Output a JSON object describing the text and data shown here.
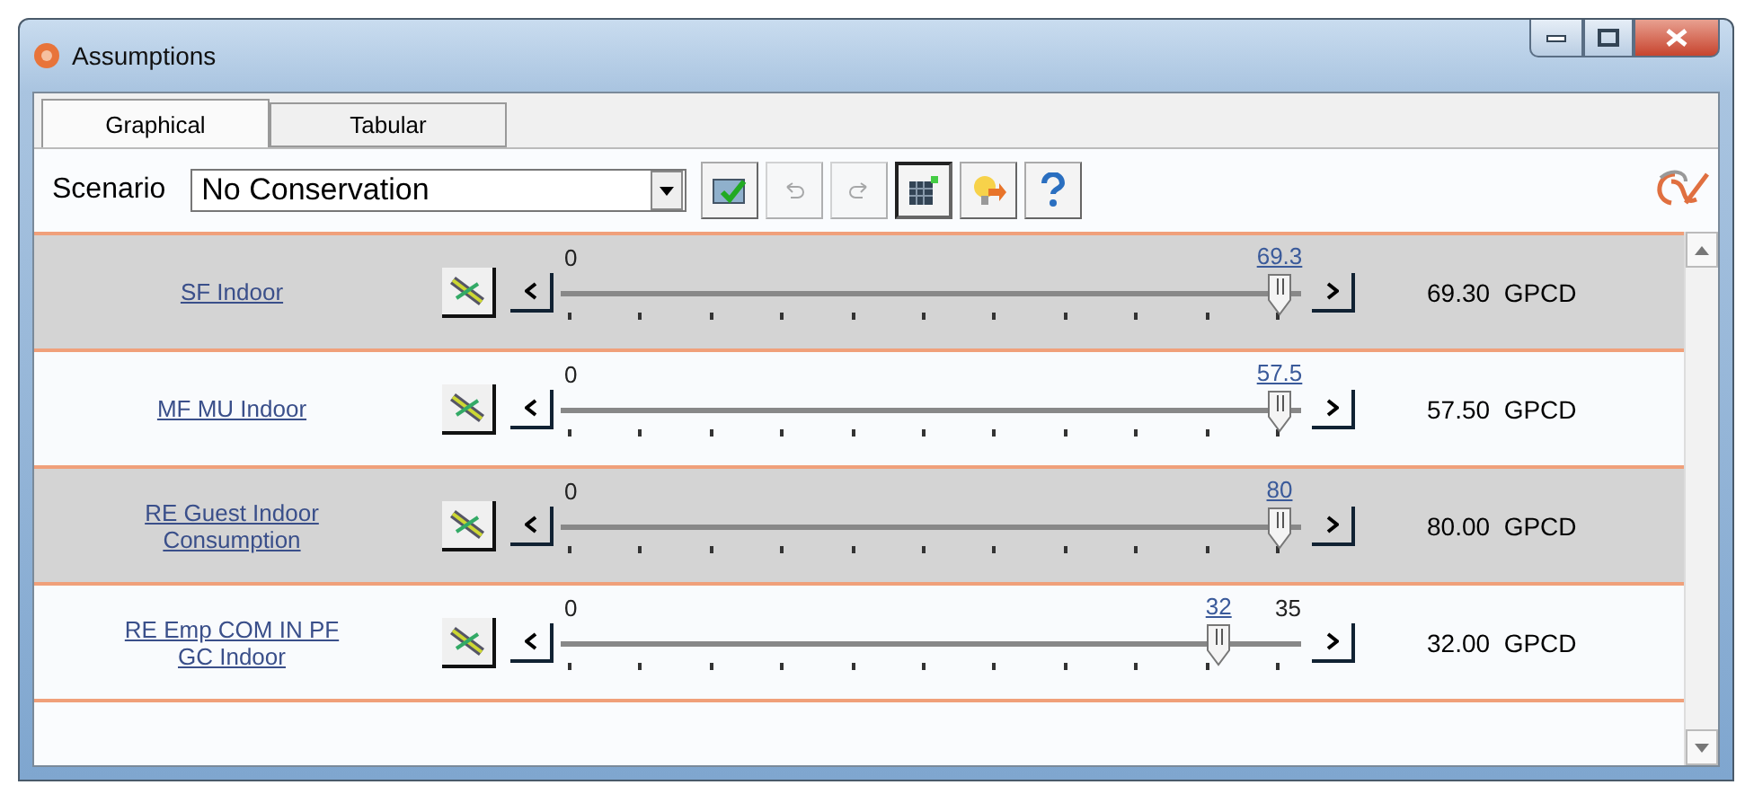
{
  "window": {
    "title": "Assumptions"
  },
  "tabs": [
    {
      "label": "Graphical",
      "selected": true
    },
    {
      "label": "Tabular",
      "selected": false
    }
  ],
  "toolbar": {
    "scenario_label": "Scenario",
    "scenario_value": "No Conservation",
    "buttons": [
      {
        "kind": "apply",
        "disabled": false,
        "pressed": false
      },
      {
        "kind": "undo",
        "disabled": true,
        "pressed": false
      },
      {
        "kind": "redo",
        "disabled": true,
        "pressed": false
      },
      {
        "kind": "grid",
        "disabled": false,
        "pressed": true
      },
      {
        "kind": "hint",
        "disabled": false,
        "pressed": false
      },
      {
        "kind": "help",
        "disabled": false,
        "pressed": false
      }
    ]
  },
  "sliders": [
    {
      "name": "SF Indoor",
      "min_label": "0",
      "value_label": "69.3",
      "level": 1,
      "reading": "69.30",
      "unit": "GPCD"
    },
    {
      "name": "MF MU Indoor",
      "min_label": "0",
      "value_label": "57.5",
      "level": 1,
      "reading": "57.50",
      "unit": "GPCD"
    },
    {
      "name": "RE Guest Indoor Consumption",
      "min_label": "0",
      "value_label": "80",
      "level": 1,
      "reading": "80.00",
      "unit": "GPCD"
    },
    {
      "name": "RE Emp COM IN PF GC Indoor",
      "min_label": "0",
      "value_label": "32",
      "max_label": "35",
      "level": 0.914,
      "reading": "32.00",
      "unit": "GPCD"
    }
  ]
}
